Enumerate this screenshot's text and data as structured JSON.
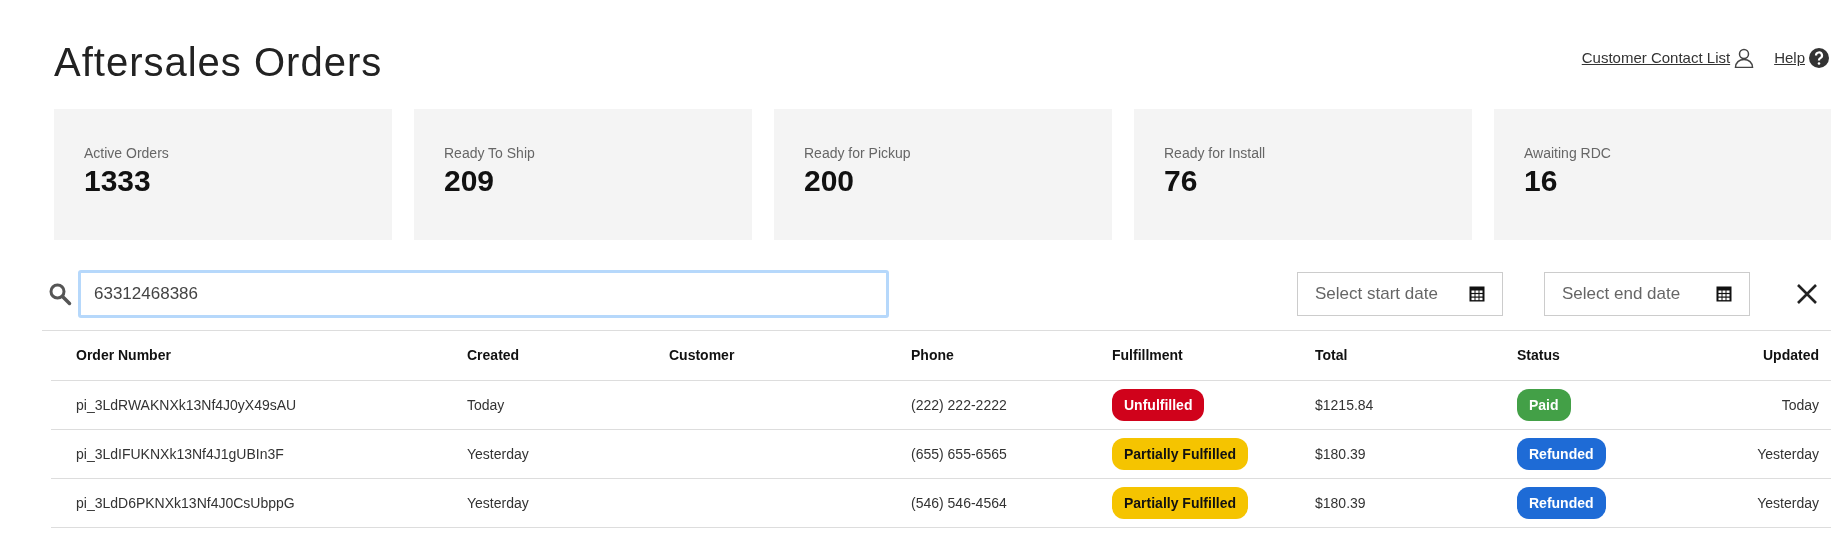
{
  "title": "Aftersales Orders",
  "header_links": [
    {
      "label": "Customer Contact List",
      "kind": "person"
    },
    {
      "label": "Help",
      "kind": "help"
    }
  ],
  "stats": [
    {
      "label": "Active Orders",
      "value": "1333"
    },
    {
      "label": "Ready To Ship",
      "value": "209"
    },
    {
      "label": "Ready for Pickup",
      "value": "200"
    },
    {
      "label": "Ready for Install",
      "value": "76"
    },
    {
      "label": "Awaiting RDC",
      "value": "16"
    }
  ],
  "search": {
    "value": "63312468386"
  },
  "date_filters": [
    {
      "placeholder": "Select start date"
    },
    {
      "placeholder": "Select end date"
    }
  ],
  "table": {
    "columns": [
      "Order Number",
      "Created",
      "Customer",
      "Phone",
      "Fulfillment",
      "Total",
      "Status",
      "Updated"
    ],
    "rows": [
      {
        "order_number": "pi_3LdRWAKNXk13Nf4J0yX49sAU",
        "created": "Today",
        "phone": "(222) 222-2222",
        "fulfillment": {
          "text": "Unfulfilled",
          "color": "#d0021b"
        },
        "total": "$1215.84",
        "status": {
          "text": "Paid",
          "color": "#43a047"
        },
        "updated": "Today"
      },
      {
        "order_number": "pi_3LdIFUKNXk13Nf4J1gUBIn3F",
        "created": "Yesterday",
        "phone": "(655) 655-6565",
        "fulfillment": {
          "text": "Partially Fulfilled",
          "color": "#f5c400"
        },
        "total": "$180.39",
        "status": {
          "text": "Refunded",
          "color": "#1e6bd6"
        },
        "updated": "Yesterday"
      },
      {
        "order_number": "pi_3LdD6PKNXk13Nf4J0CsUbppG",
        "created": "Yesterday",
        "phone": "(546) 546-4564",
        "fulfillment": {
          "text": "Partially Fulfilled",
          "color": "#f5c400"
        },
        "total": "$180.39",
        "status": {
          "text": "Refunded",
          "color": "#1e6bd6"
        },
        "updated": "Yesterday"
      }
    ]
  }
}
